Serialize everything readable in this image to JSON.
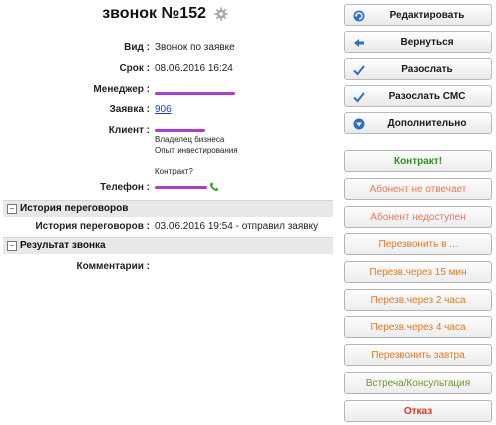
{
  "header": {
    "title": "звонок №152"
  },
  "fields": [
    {
      "label": "Вид :",
      "value": "Звонок по заявке"
    },
    {
      "label": "Срок :",
      "value": "08.06.2016 16:24"
    },
    {
      "label": "Менеджер :"
    },
    {
      "label": "Заявка :",
      "link": "906"
    },
    {
      "label": "Клиент :",
      "lines": [
        "Владелец бизнеса",
        "Опыт инвестирования",
        "",
        "Контракт?"
      ]
    },
    {
      "label": "Телефон :"
    }
  ],
  "sections": {
    "history": {
      "title": "История переговоров",
      "label": "История переговоров :",
      "value": "03.06.2016 19:54 - отправил заявку"
    },
    "result": {
      "title": "Результат звонка",
      "label": "Комментарии :"
    }
  },
  "actions": [
    {
      "label": "Редактировать",
      "icon": "refresh-icon"
    },
    {
      "label": "Вернуться",
      "icon": "arrow-left-icon"
    },
    {
      "label": "Разослать",
      "icon": "check-icon"
    },
    {
      "label": "Разослать СМС",
      "icon": "check-icon"
    },
    {
      "label": "Дополнительно",
      "icon": "triangle-down-icon"
    }
  ],
  "statuses": [
    {
      "label": "Контракт!",
      "color": "#2f8f1f"
    },
    {
      "label": "Абонент не отвечает",
      "color": "#e8785a"
    },
    {
      "label": "Абонент недоступен",
      "color": "#e8785a"
    },
    {
      "label": "Перезвонить в ...",
      "color": "#e07a28"
    },
    {
      "label": "Перезв.через 15 мин",
      "color": "#e07a28"
    },
    {
      "label": "Перезв.через 2 часа",
      "color": "#e07a28"
    },
    {
      "label": "Перезв.через 4 часа",
      "color": "#e07a28"
    },
    {
      "label": "Перезвонить завтра",
      "color": "#e07a28"
    },
    {
      "label": "Встреча/Консультация",
      "color": "#6f9a2f"
    },
    {
      "label": "Отказ",
      "color": "#e0321c"
    }
  ],
  "colors": {
    "redaction": "#b13cc9",
    "phone_icon": "#3aa52b",
    "action_icon": "#2f6fc4"
  }
}
